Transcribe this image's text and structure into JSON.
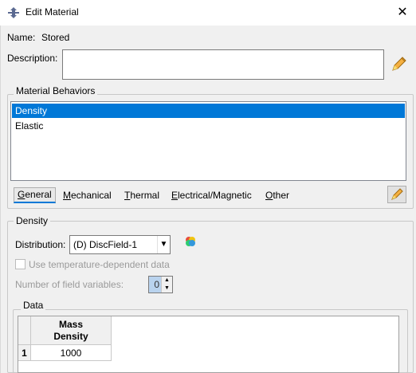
{
  "window": {
    "title": "Edit Material",
    "close_glyph": "✕"
  },
  "name": {
    "label": "Name:",
    "value": "Stored"
  },
  "description": {
    "label": "Description:",
    "value": ""
  },
  "material_behaviors": {
    "title": "Material Behaviors",
    "items": [
      {
        "label": "Density",
        "selected": true
      },
      {
        "label": "Elastic",
        "selected": false
      }
    ]
  },
  "menu": [
    {
      "label": "General",
      "underline": "G"
    },
    {
      "label": "Mechanical",
      "underline": "M"
    },
    {
      "label": "Thermal",
      "underline": "T"
    },
    {
      "label": "Electrical/Magnetic",
      "underline": "E"
    },
    {
      "label": "Other",
      "underline": "O"
    }
  ],
  "density": {
    "title": "Density",
    "distribution_label": "Distribution:",
    "distribution_value": "(D) DiscField-1",
    "temp_dependent_label": "Use temperature-dependent data",
    "field_vars_label": "Number of field variables:",
    "field_vars_value": "0"
  },
  "data": {
    "title": "Data",
    "columns": [
      {
        "line1": "Mass",
        "line2": "Density"
      }
    ],
    "rows": [
      {
        "index": "1",
        "values": [
          "1000"
        ]
      }
    ]
  },
  "colors": {
    "accent": "#0078d7",
    "dialog_bg": "#f0f0f0"
  },
  "icons": [
    "app-icon",
    "close-icon",
    "pencil-icon",
    "edit-icon",
    "field-icon",
    "chevron-down-icon"
  ]
}
